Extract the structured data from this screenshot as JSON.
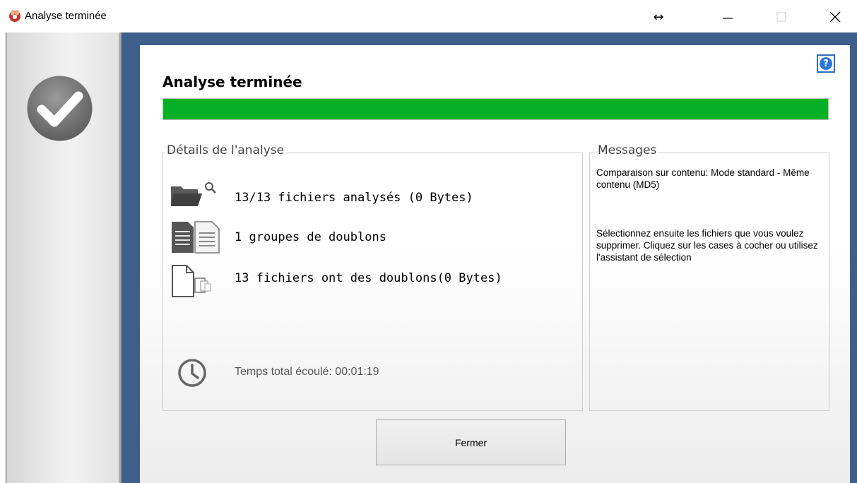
{
  "window": {
    "title": "Analyse terminée",
    "controls": {
      "resize_glyph": "↔",
      "minimize": "minimize-icon",
      "maximize": "maximize-icon",
      "close": "close-icon"
    }
  },
  "main": {
    "heading": "Analyse terminée",
    "progress": 1.0,
    "progress_color": "#06b025",
    "help_icon": "help-icon",
    "help_glyph": "?"
  },
  "details": {
    "legend": "Détails de l'analyse",
    "items": [
      {
        "icon": "folder-search-icon",
        "text": "13/13 fichiers analysés (0 Bytes)"
      },
      {
        "icon": "duplicate-documents-icon",
        "text": "1 groupes de doublons"
      },
      {
        "icon": "file-copies-icon",
        "text": "13 fichiers ont des doublons(0 Bytes)"
      }
    ],
    "elapsed_icon": "clock-icon",
    "elapsed": "Temps total écoulé: 00:01:19"
  },
  "messages": {
    "legend": "Messages",
    "lines": [
      "Comparaison sur contenu: Mode standard - Même contenu (MD5)",
      "Sélectionnez ensuite les fichiers que vous voulez supprimer. Cliquez sur les cases à cocher ou utilisez l'assistant de sélection"
    ]
  },
  "footer": {
    "close_label": "Fermer"
  },
  "sidebar": {
    "status_icon": "checkmark-icon"
  },
  "colors": {
    "frame": "#3d5f8a",
    "accent_blue": "#2d78d6"
  }
}
